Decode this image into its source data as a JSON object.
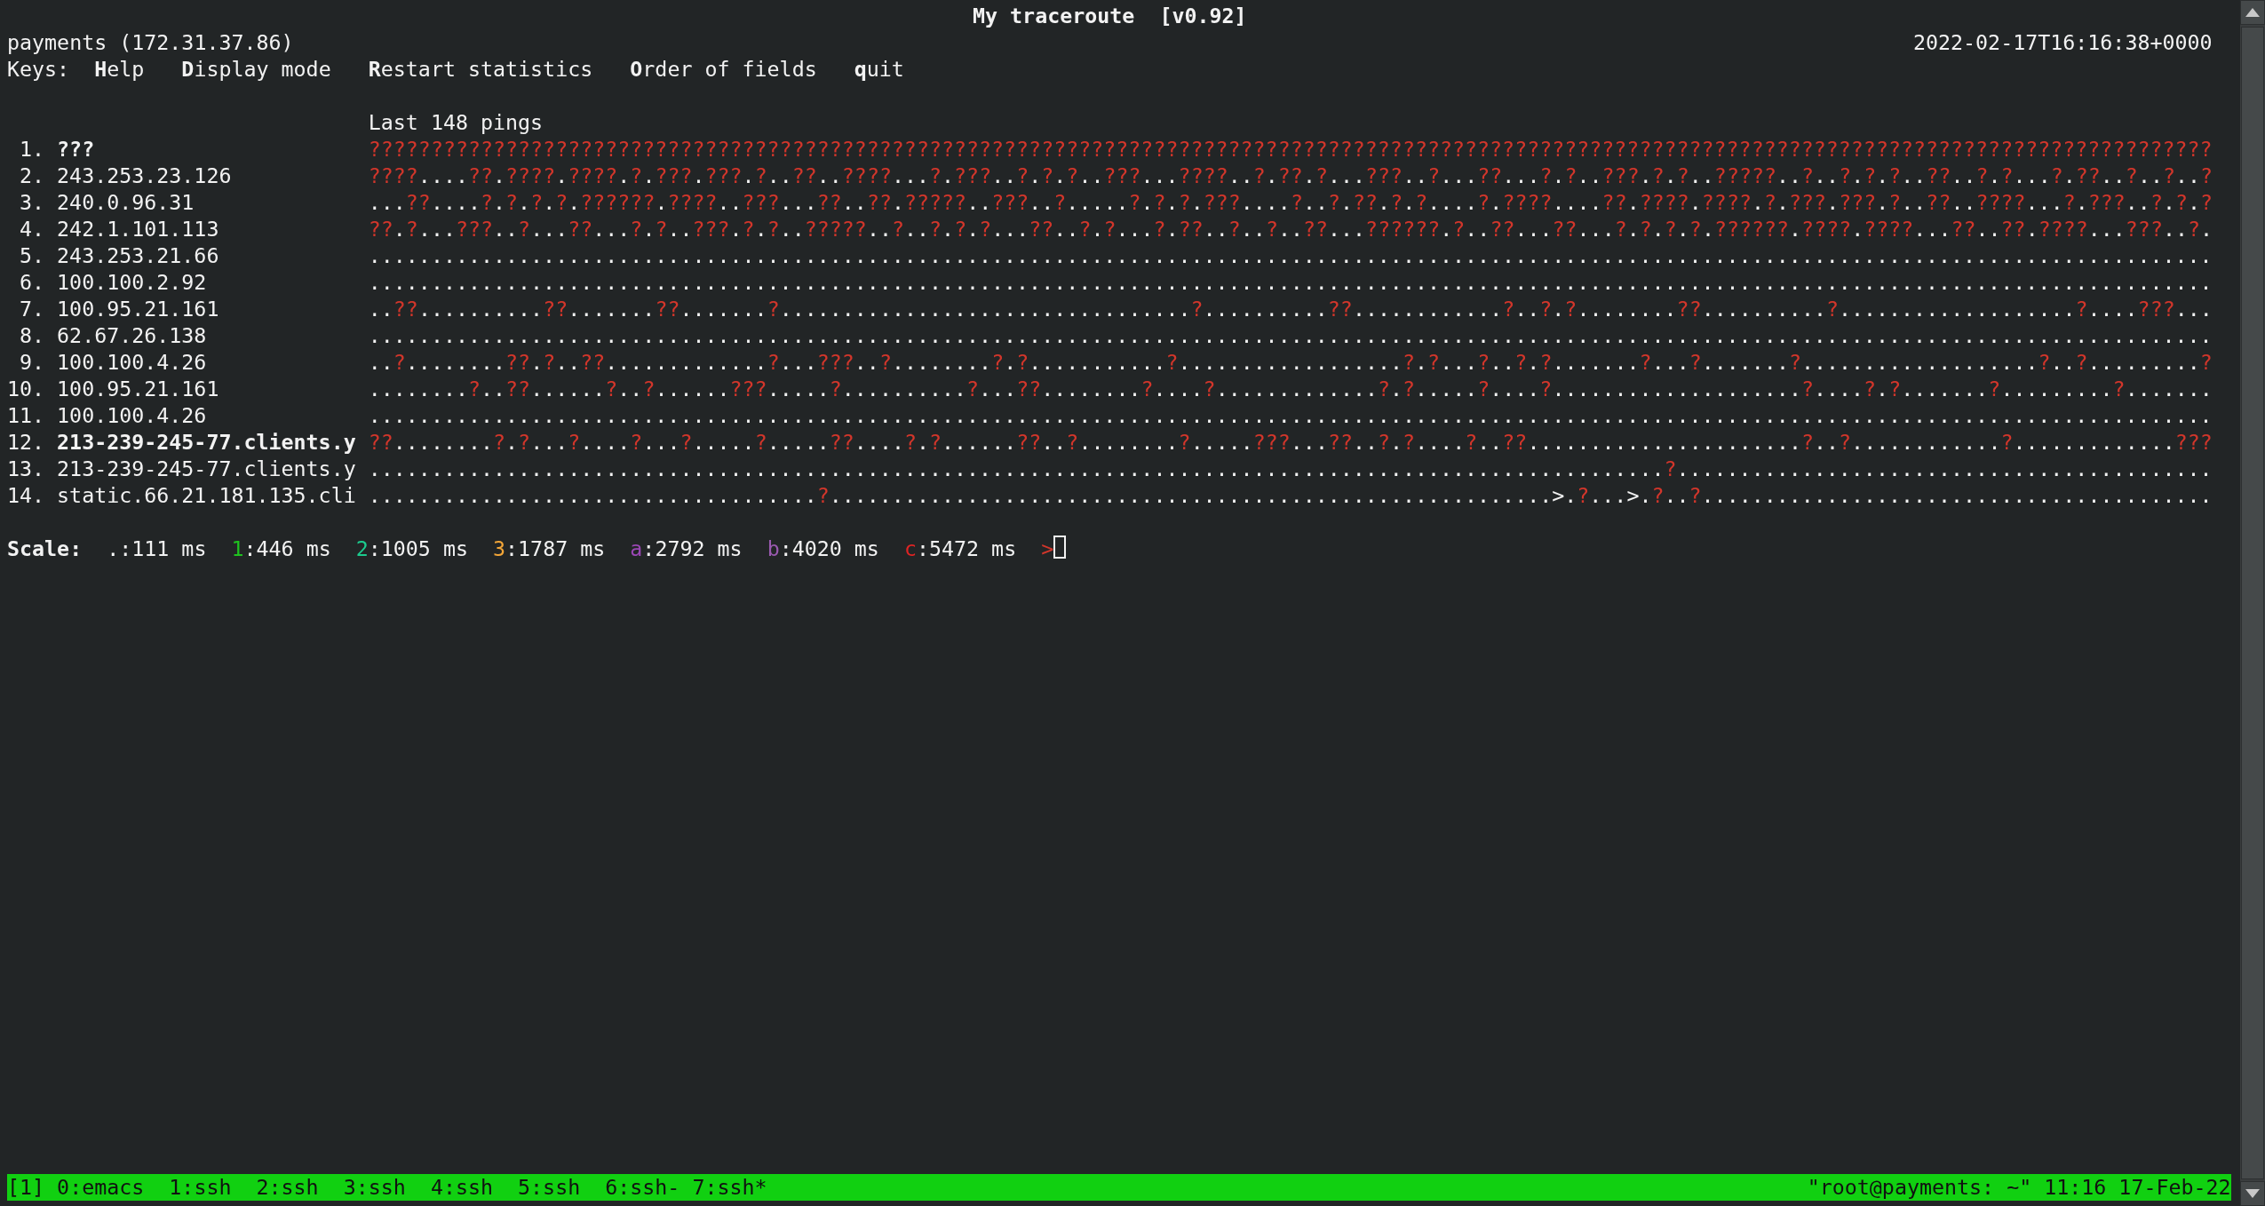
{
  "window": {
    "title": "My traceroute  [v0.92]"
  },
  "header": {
    "host": "payments (172.31.37.86)",
    "timestamp": "2022-02-17T16:16:38+0000"
  },
  "keys": {
    "label": "Keys:",
    "items": [
      "**H**elp",
      "**D**isplay mode",
      "**R**estart statistics",
      "**O**rder of fields",
      "**q**uit"
    ]
  },
  "history_title": "Last 148 pings",
  "hops": [
    {
      "number": "1.",
      "host": "???",
      "bold": true,
      "pings": "????????????????????????????????????????????????????????????????????????????????????????????????????????????????????????????????????????????????????"
    },
    {
      "number": "2.",
      "host": "243.253.23.126",
      "bold": false,
      "pings": "????....??.????.????.?.???.???.?..??..????...?.???..?.?.?..???...????..?.??.?...???..?...??...?.?..???.?.?..?????..?..?.?.?..??..?.?...?.??..?..?..?"
    },
    {
      "number": "3.",
      "host": "240.0.96.31",
      "bold": false,
      "pings": "...??....?.?.?.?.??????.????..???...??..??.?????..???..?.....?.?.?.???....?..?.??.?.?....?.????....??.????.????.?.???.???.?..??..????...?.???..?.?.?"
    },
    {
      "number": "4.",
      "host": "242.1.101.113",
      "bold": false,
      "pings": "??.?...???..?...??...?.?..???.?.?..?????..?..?.?.?...??..?.?...?.??..?..?..??...??????.?..??...??...?.?.?.?.??????.????.????...??..??.????...???..?."
    },
    {
      "number": "5.",
      "host": "243.253.21.66",
      "bold": false,
      "pings": "...................................................................................................................................................."
    },
    {
      "number": "6.",
      "host": "100.100.2.92",
      "bold": false,
      "pings": "...................................................................................................................................................."
    },
    {
      "number": "7.",
      "host": "100.95.21.161",
      "bold": false,
      "pings": "..??..........??.......??.......?.................................?..........??............?..?.?........??..........?...................?....???..."
    },
    {
      "number": "8.",
      "host": "62.67.26.138",
      "bold": false,
      "pings": "...................................................................................................................................................."
    },
    {
      "number": "9.",
      "host": "100.100.4.26",
      "bold": false,
      "pings": "..?........??.?..??.............?...???..?........?.?...........?..................?.?...?..?.?.......?...?.......?...................?..?.........?"
    },
    {
      "number": "10.",
      "host": "100.95.21.161",
      "bold": false,
      "pings": "........?..??......?..?......???.....?..........?...??........?....?.............?.?.....?....?....................?....?.?.......?.........?......."
    },
    {
      "number": "11.",
      "host": "100.100.4.26",
      "bold": false,
      "pings": "...................................................................................................................................................."
    },
    {
      "number": "12.",
      "host": "213-239-245-77.clients.y",
      "bold": true,
      "pings": "??........?.?...?....?...?.....?.....??....?.?......??..?........?.....???...??..?.?....?..??......................?..?............?.............???"
    },
    {
      "number": "13.",
      "host": "213-239-245-77.clients.y",
      "bold": false,
      "pings": "........................................................................................................?..........................................."
    },
    {
      "number": "14.",
      "host": "static.66.21.181.135.cli",
      "bold": false,
      "pings": "....................................?..........................................................>.?...>.?..?........................................."
    }
  ],
  "scale": {
    "label": "Scale:",
    "items": [
      {
        "key": ".",
        "value": ":111 ms",
        "color": "#ffffff"
      },
      {
        "key": "1",
        "value": ":446 ms",
        "color": "#1fc21f"
      },
      {
        "key": "2",
        "value": ":1005 ms",
        "color": "#1ccb8e"
      },
      {
        "key": "3",
        "value": ":1787 ms",
        "color": "#f3a638"
      },
      {
        "key": "a",
        "value": ":2792 ms",
        "color": "#9b47b5"
      },
      {
        "key": "b",
        "value": ":4020 ms",
        "color": "#9a5ab0"
      },
      {
        "key": "c",
        "value": ":5472 ms",
        "color": "#e02424"
      }
    ],
    "prompt": ">"
  },
  "status_bar": {
    "left": "[1] 0:emacs  1:ssh  2:ssh  3:ssh  4:ssh  5:ssh  6:ssh- 7:ssh*",
    "right": "\"root@payments: ~\" 11:16 17-Feb-22"
  }
}
